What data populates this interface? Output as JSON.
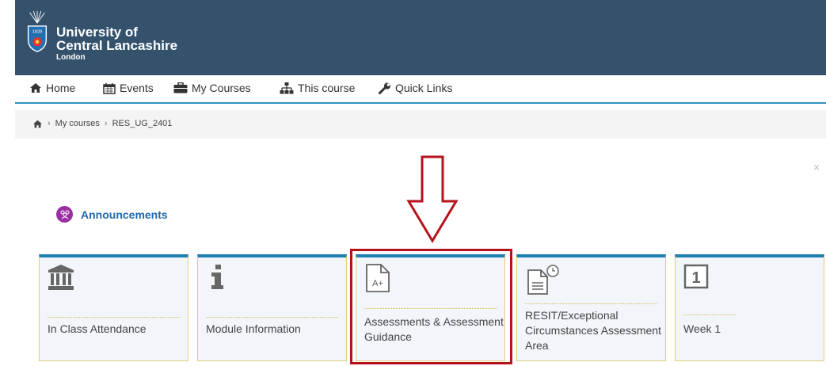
{
  "brand": {
    "line1": "University of",
    "line2": "Central Lancashire",
    "line3": "London",
    "shield_year": "1828",
    "color": "#34526c"
  },
  "nav": {
    "items": [
      {
        "label": "Home",
        "icon": "home-icon"
      },
      {
        "label": "Events",
        "icon": "calendar-icon"
      },
      {
        "label": "My Courses",
        "icon": "briefcase-icon"
      },
      {
        "label": "This course",
        "icon": "sitemap-icon"
      },
      {
        "label": "Quick Links",
        "icon": "wrench-icon"
      }
    ]
  },
  "breadcrumb": {
    "items": [
      "My courses",
      "RES_UG_2401"
    ],
    "separator": "›"
  },
  "close_label": "×",
  "announcements": {
    "label": "Announcements",
    "color": "#9a2fa3"
  },
  "tiles": [
    {
      "label": "In Class Attendance",
      "icon": "institution-icon"
    },
    {
      "label": "Module Information",
      "icon": "info-icon"
    },
    {
      "label": "Assessments & Assessment Guidance",
      "icon": "grade-file-icon",
      "icon_text": "A+",
      "highlighted": true
    },
    {
      "label": "RESIT/Exceptional Circumstances Assessment Area",
      "icon": "document-clock-icon"
    },
    {
      "label": "Week 1",
      "icon": "number-one-icon",
      "icon_text": "1"
    }
  ],
  "colors": {
    "accent": "#2a8fbf",
    "highlight": "#b5121b",
    "tile_bg": "#f2f6fa"
  }
}
